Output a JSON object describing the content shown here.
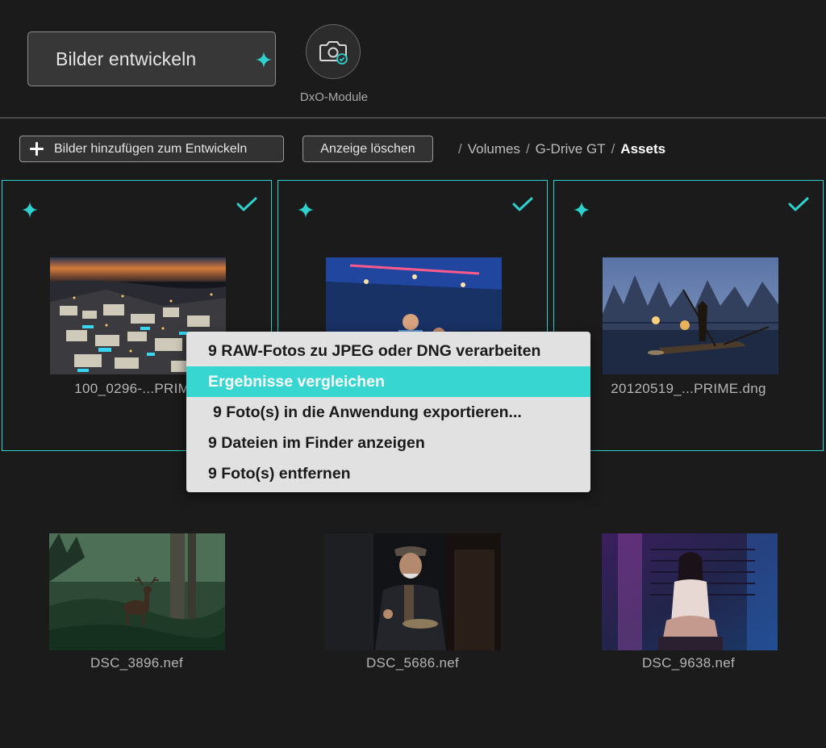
{
  "topbar": {
    "develop_label": "Bilder entwickeln",
    "module_label": "DxO-Module"
  },
  "toolbar": {
    "add_label": "Bilder hinzufügen zum Entwickeln",
    "clear_label": "Anzeige löschen",
    "breadcrumb": [
      "Volumes",
      "G-Drive GT",
      "Assets"
    ]
  },
  "photos": [
    {
      "name": "100_0296-...PRIME",
      "selected": true
    },
    {
      "name": "",
      "selected": true
    },
    {
      "name": "20120519_...PRIME.dng",
      "selected": true
    },
    {
      "name": "DSC_3896.nef",
      "selected": false
    },
    {
      "name": "DSC_5686.nef",
      "selected": false
    },
    {
      "name": "DSC_9638.nef",
      "selected": false
    }
  ],
  "context_menu": {
    "items": [
      "9 RAW-Fotos zu JPEG oder DNG verarbeiten",
      "Ergebnisse vergleichen",
      "9 Foto(s) in die Anwendung exportieren...",
      "9 Dateien im Finder anzeigen",
      "9 Foto(s) entfernen"
    ],
    "highlighted_index": 1
  },
  "colors": {
    "accent": "#2ed1cd",
    "menu_highlight": "#38d6d0",
    "background": "#1b1b1c"
  },
  "icons": {
    "develop": "sparkle-icon",
    "module": "camera-check-icon",
    "add": "plus-icon",
    "selected": "checkmark-icon"
  }
}
